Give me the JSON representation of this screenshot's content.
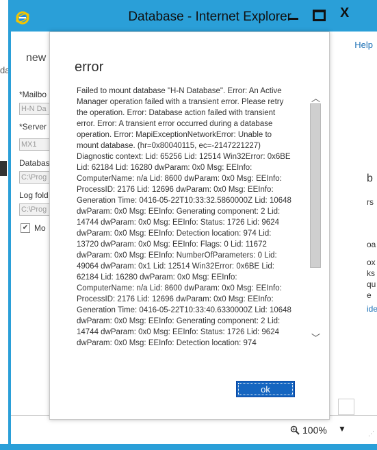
{
  "window": {
    "title": "Database - Internet Explorer",
    "minimize_label": "",
    "close_glyph": "X"
  },
  "background_form": {
    "heading": "new",
    "left_fragment": "da",
    "fields": [
      {
        "label": "*Mailbo",
        "value": "H-N Da"
      },
      {
        "label": "*Server",
        "value": "MX1"
      },
      {
        "label": "Databas",
        "value": "C:\\Prog"
      },
      {
        "label": "Log fold",
        "value": "C:\\Prog"
      }
    ],
    "checkbox_label": "Mo",
    "help_link": "Help",
    "right_fragments": [
      "b",
      "rs",
      "oa",
      "ox",
      "ks",
      "qu",
      "e",
      "ide"
    ]
  },
  "dialog": {
    "title": "error",
    "message": "Failed to mount database \"H-N Database\". Error: An Active Manager operation failed with a transient error. Please retry the operation. Error: Database action failed with transient error. Error: A transient error occurred during a database operation. Error: MapiExceptionNetworkError: Unable to mount database. (hr=0x80040115, ec=-2147221227) Diagnostic context: Lid: 65256 Lid: 12514 Win32Error: 0x6BE Lid: 62184 Lid: 16280 dwParam: 0x0 Msg: EEInfo: ComputerName: n/a Lid: 8600 dwParam: 0x0 Msg: EEInfo: ProcessID: 2176 Lid: 12696 dwParam: 0x0 Msg: EEInfo: Generation Time: 0416-05-22T10:33:32.5860000Z Lid: 10648 dwParam: 0x0 Msg: EEInfo: Generating component: 2 Lid: 14744 dwParam: 0x0 Msg: EEInfo: Status: 1726 Lid: 9624 dwParam: 0x0 Msg: EEInfo: Detection location: 974 Lid: 13720 dwParam: 0x0 Msg: EEInfo: Flags: 0 Lid: 11672 dwParam: 0x0 Msg: EEInfo: NumberOfParameters: 0 Lid: 49064 dwParam: 0x1 Lid: 12514 Win32Error: 0x6BE Lid: 62184 Lid: 16280 dwParam: 0x0 Msg: EEInfo: ComputerName: n/a Lid: 8600 dwParam: 0x0 Msg: EEInfo: ProcessID: 2176 Lid: 12696 dwParam: 0x0 Msg: EEInfo: Generation Time: 0416-05-22T10:33:40.6330000Z Lid: 10648 dwParam: 0x0 Msg: EEInfo: Generating component: 2 Lid: 14744 dwParam: 0x0 Msg: EEInfo: Status: 1726 Lid: 9624 dwParam: 0x0 Msg: EEInfo: Detection location: 974",
    "ok_label": "ok"
  },
  "statusbar": {
    "zoom": "100%"
  },
  "colors": {
    "titlebar": "#2a9fd8",
    "ok_button": "#1565c0",
    "link": "#1a6fb5"
  },
  "icons": [
    "ie-logo-icon",
    "minimize-icon",
    "maximize-icon",
    "close-icon",
    "scroll-up-icon",
    "scroll-down-icon",
    "zoom-icon",
    "chevron-down-icon",
    "checkmark-icon"
  ]
}
